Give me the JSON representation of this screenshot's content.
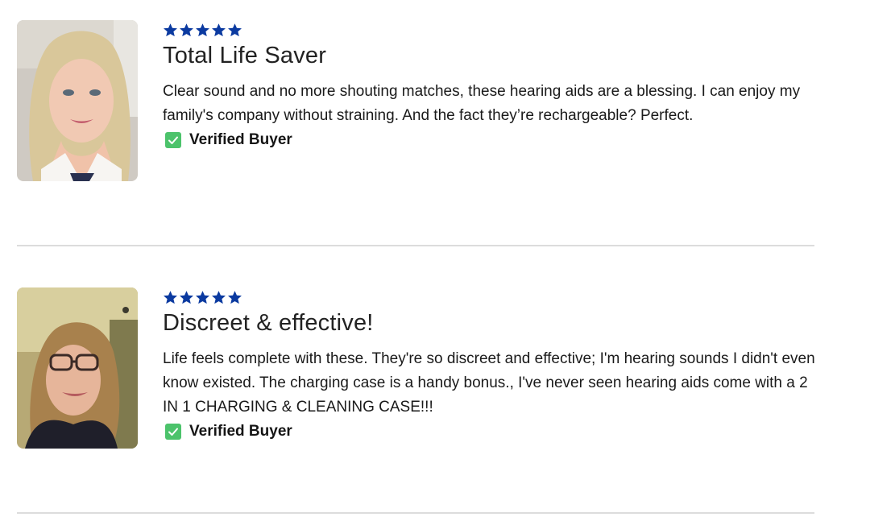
{
  "reviews": [
    {
      "rating": 5,
      "title": "Total Life Saver",
      "text": "Clear sound and no more shouting matches, these hearing aids are a blessing. I can enjoy my family's company without straining. And the fact they’re rechargeable? Perfect.",
      "badge": "Verified Buyer"
    },
    {
      "rating": 5,
      "title": "Discreet & effective!",
      "text": "Life feels complete with these. They're so discreet and effective; I'm hearing sounds I didn't even know existed. The charging case is a handy bonus., I've never seen hearing aids come with a 2 IN 1 CHARGING & CLEANING CASE!!!",
      "badge": "Verified Buyer"
    }
  ],
  "colors": {
    "star": "#0b3aa0",
    "check": "#4cc36b",
    "divider": "#dcdcdc"
  },
  "icons": {
    "star": "star-icon",
    "check": "checkbox-check-icon"
  }
}
